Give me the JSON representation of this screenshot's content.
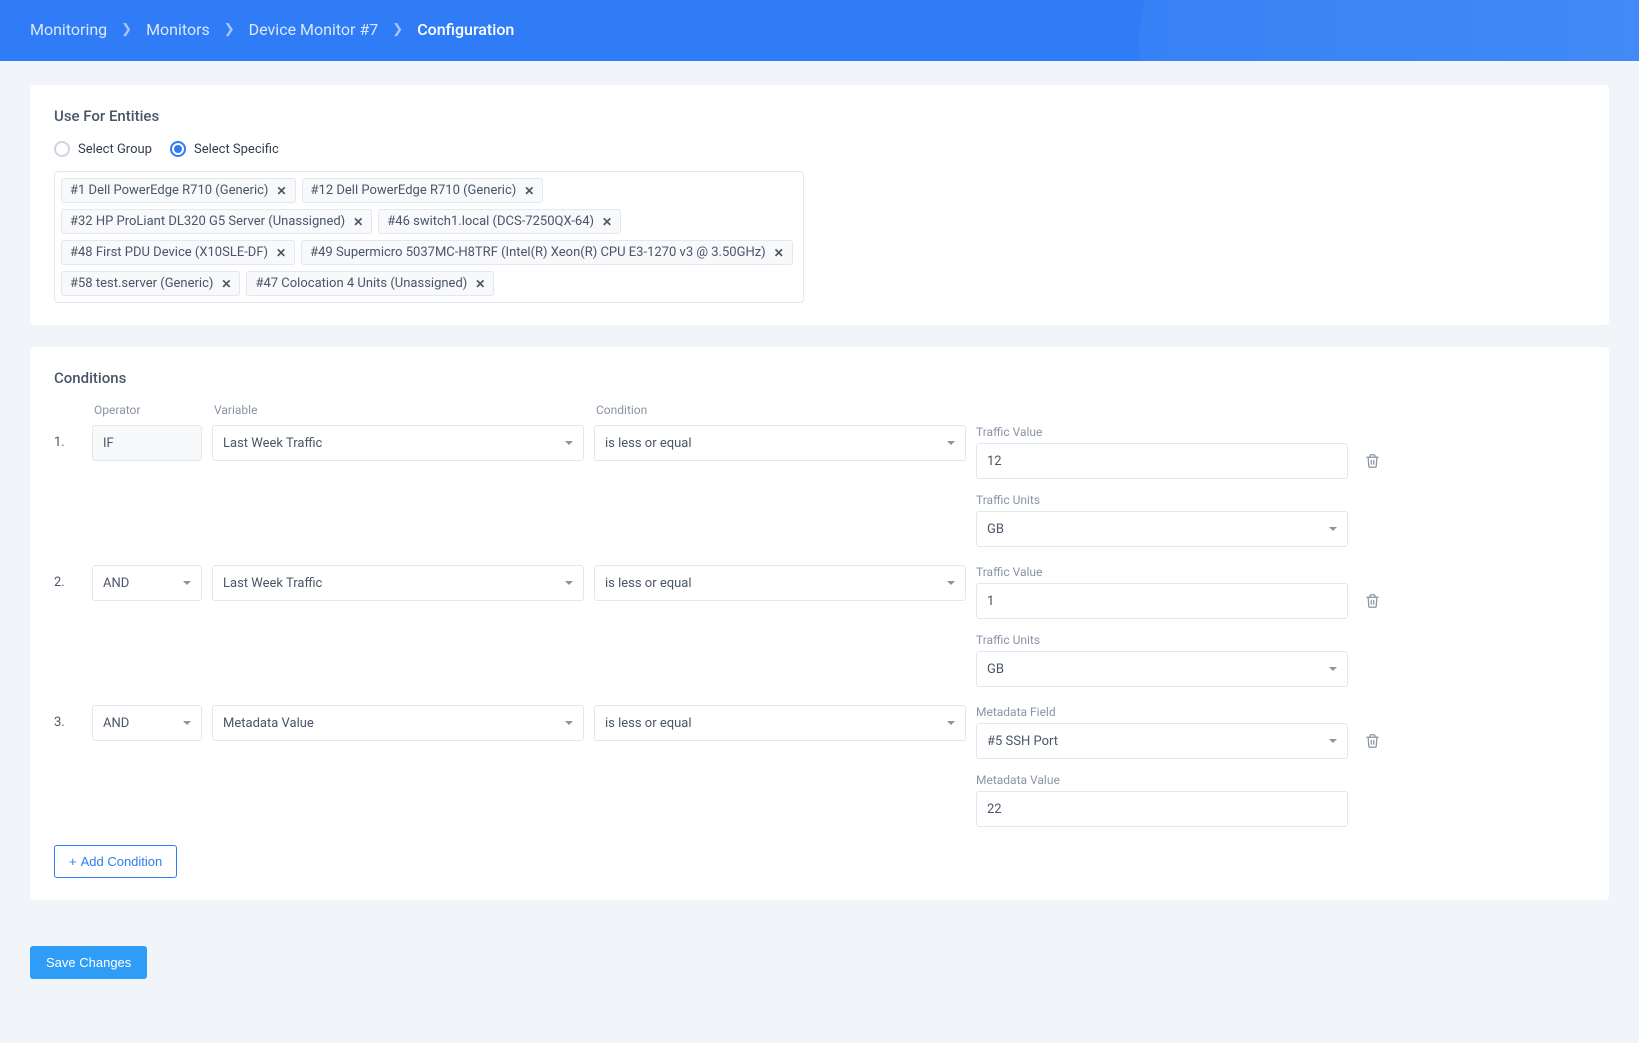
{
  "breadcrumb": [
    {
      "label": "Monitoring",
      "current": false
    },
    {
      "label": "Monitors",
      "current": false
    },
    {
      "label": "Device Monitor #7",
      "current": false
    },
    {
      "label": "Configuration",
      "current": true
    }
  ],
  "entities": {
    "title": "Use For Entities",
    "radios": {
      "group": "Select Group",
      "specific": "Select Specific",
      "selected": "specific"
    },
    "tags": [
      "#1 Dell PowerEdge R710 (Generic)",
      "#12 Dell PowerEdge R710 (Generic)",
      "#32 HP ProLiant DL320 G5 Server (Unassigned)",
      "#46 switch1.local (DCS-7250QX-64)",
      "#48 First PDU Device (X10SLE-DF)",
      "#49 Supermicro 5037MC-H8TRF (Intel(R) Xeon(R) CPU E3-1270 v3 @ 3.50GHz)",
      "#58 test.server (Generic)",
      "#47 Colocation 4 Units (Unassigned)"
    ]
  },
  "conditions": {
    "title": "Conditions",
    "columns": {
      "operator": "Operator",
      "variable": "Variable",
      "condition": "Condition"
    },
    "rows": [
      {
        "num": "1.",
        "operator": "IF",
        "operator_select": false,
        "variable": "Last Week Traffic",
        "condition": "is less or equal",
        "values": [
          {
            "label": "Traffic Value",
            "type": "input",
            "value": "12"
          },
          {
            "label": "Traffic Units",
            "type": "select",
            "value": "GB"
          }
        ]
      },
      {
        "num": "2.",
        "operator": "AND",
        "operator_select": true,
        "variable": "Last Week Traffic",
        "condition": "is less or equal",
        "values": [
          {
            "label": "Traffic Value",
            "type": "input",
            "value": "1"
          },
          {
            "label": "Traffic Units",
            "type": "select",
            "value": "GB"
          }
        ]
      },
      {
        "num": "3.",
        "operator": "AND",
        "operator_select": true,
        "variable": "Metadata Value",
        "condition": "is less or equal",
        "values": [
          {
            "label": "Metadata Field",
            "type": "select",
            "value": "#5 SSH Port"
          },
          {
            "label": "Metadata Value",
            "type": "input",
            "value": "22"
          }
        ]
      }
    ],
    "add_button": "Add Condition"
  },
  "save_button": "Save Changes"
}
